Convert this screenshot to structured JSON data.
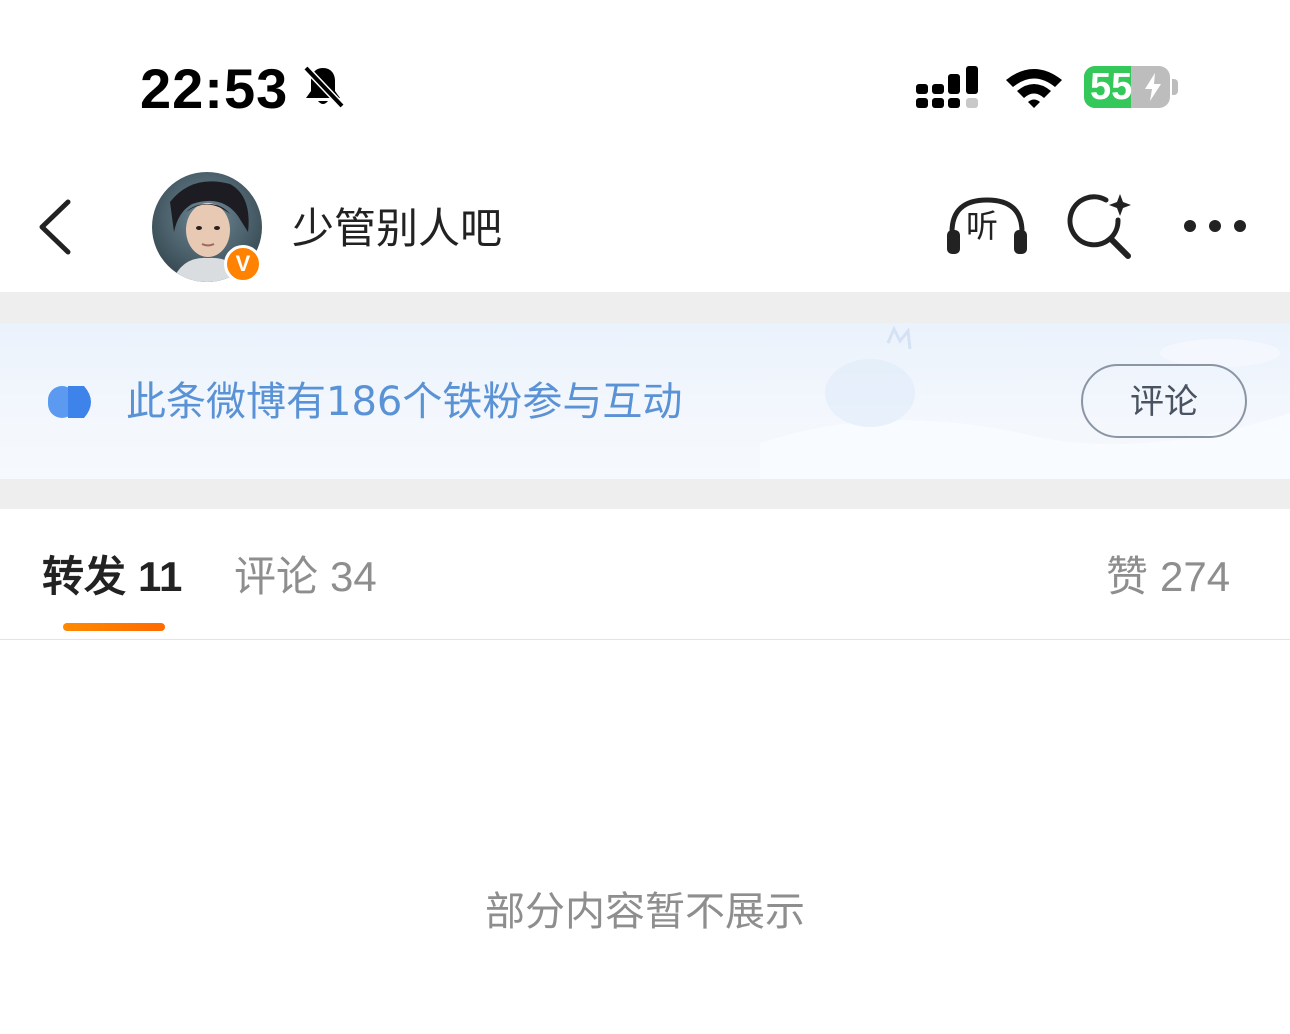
{
  "status_bar": {
    "time": "22:53",
    "battery_level": "55",
    "battery_fraction": 0.55,
    "silent_mode_icon": "bell-slash-icon",
    "signal_icon": "cellular-signal-icon",
    "wifi_icon": "wifi-icon",
    "charging_icon": "bolt-icon"
  },
  "nav": {
    "back_icon": "chevron-left-icon",
    "user_name": "少管别人吧",
    "verified_badge": "V",
    "verified_color": "#ff8200",
    "listen_label": "听",
    "ai_search_icon": "ai-search-icon",
    "more_icon": "more-dots-icon"
  },
  "fans_banner": {
    "text": "此条微博有186个铁粉参与互动",
    "button_label": "评论",
    "icon": "fans-icon",
    "text_color": "#5a92d6"
  },
  "tabs": [
    {
      "label": "转发",
      "count": "11",
      "active": true
    },
    {
      "label": "评论",
      "count": "34",
      "active": false
    },
    {
      "label": "赞",
      "count": "274",
      "active": false
    }
  ],
  "accent_color": "#ff7a00",
  "content": {
    "empty_message": "部分内容暂不展示"
  }
}
